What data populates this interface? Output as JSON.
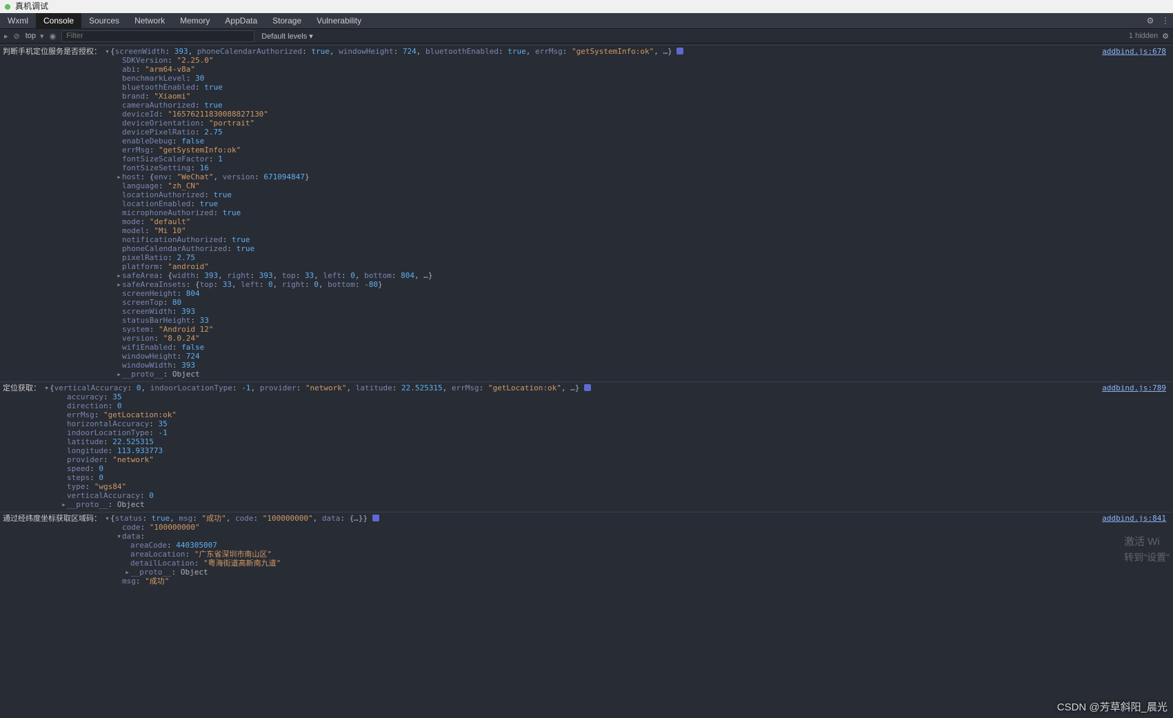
{
  "window": {
    "title": "真机调试"
  },
  "tabs": [
    "Wxml",
    "Console",
    "Sources",
    "Network",
    "Memory",
    "AppData",
    "Storage",
    "Vulnerability"
  ],
  "active_tab": "Console",
  "toolbar": {
    "context": "top",
    "filter_placeholder": "Filter",
    "levels": "Default levels",
    "hidden": "1 hidden"
  },
  "msgs": [
    {
      "label": "判断手机定位服务是否授权：",
      "source": "addbind.js:678",
      "summary": {
        "screenWidth": 393,
        "phoneCalendarAuthorized": true,
        "windowHeight": 724,
        "bluetoothEnabled": true,
        "errMsg": "getSystemInfo:ok",
        "more": "…"
      },
      "props": [
        {
          "k": "SDKVersion",
          "v": "2.25.0",
          "t": "str"
        },
        {
          "k": "abi",
          "v": "arm64-v8a",
          "t": "str"
        },
        {
          "k": "benchmarkLevel",
          "v": 30,
          "t": "num"
        },
        {
          "k": "bluetoothEnabled",
          "v": true,
          "t": "bool"
        },
        {
          "k": "brand",
          "v": "Xiaomi",
          "t": "str"
        },
        {
          "k": "cameraAuthorized",
          "v": true,
          "t": "bool"
        },
        {
          "k": "deviceId",
          "v": "16576211830088827130",
          "t": "str"
        },
        {
          "k": "deviceOrientation",
          "v": "portrait",
          "t": "str"
        },
        {
          "k": "devicePixelRatio",
          "v": 2.75,
          "t": "num"
        },
        {
          "k": "enableDebug",
          "v": false,
          "t": "bool"
        },
        {
          "k": "errMsg",
          "v": "getSystemInfo:ok",
          "t": "str"
        },
        {
          "k": "fontSizeScaleFactor",
          "v": 1,
          "t": "num"
        },
        {
          "k": "fontSizeSetting",
          "v": 16,
          "t": "num"
        },
        {
          "k": "host",
          "raw": "{env: \"WeChat\", version: 671094847}",
          "t": "obj",
          "tri": true
        },
        {
          "k": "language",
          "v": "zh_CN",
          "t": "str"
        },
        {
          "k": "locationAuthorized",
          "v": true,
          "t": "bool"
        },
        {
          "k": "locationEnabled",
          "v": true,
          "t": "bool"
        },
        {
          "k": "microphoneAuthorized",
          "v": true,
          "t": "bool"
        },
        {
          "k": "mode",
          "v": "default",
          "t": "str"
        },
        {
          "k": "model",
          "v": "Mi 10",
          "t": "str"
        },
        {
          "k": "notificationAuthorized",
          "v": true,
          "t": "bool"
        },
        {
          "k": "phoneCalendarAuthorized",
          "v": true,
          "t": "bool"
        },
        {
          "k": "pixelRatio",
          "v": 2.75,
          "t": "num"
        },
        {
          "k": "platform",
          "v": "android",
          "t": "str"
        },
        {
          "k": "safeArea",
          "raw": "{width: 393, right: 393, top: 33, left: 0, bottom: 804, …}",
          "t": "obj",
          "tri": true
        },
        {
          "k": "safeAreaInsets",
          "raw": "{top: 33, left: 0, right: 0, bottom: -80}",
          "t": "obj",
          "tri": true
        },
        {
          "k": "screenHeight",
          "v": 804,
          "t": "num"
        },
        {
          "k": "screenTop",
          "v": 80,
          "t": "num"
        },
        {
          "k": "screenWidth",
          "v": 393,
          "t": "num"
        },
        {
          "k": "statusBarHeight",
          "v": 33,
          "t": "num"
        },
        {
          "k": "system",
          "v": "Android 12",
          "t": "str"
        },
        {
          "k": "version",
          "v": "8.0.24",
          "t": "str"
        },
        {
          "k": "wifiEnabled",
          "v": false,
          "t": "bool"
        },
        {
          "k": "windowHeight",
          "v": 724,
          "t": "num"
        },
        {
          "k": "windowWidth",
          "v": 393,
          "t": "num"
        },
        {
          "k": "__proto__",
          "raw": "Object",
          "t": "raw",
          "tri": true
        }
      ]
    },
    {
      "label": "定位获取：",
      "source": "addbind.js:789",
      "summary": {
        "verticalAccuracy": 0,
        "indoorLocationType": -1,
        "provider": "network",
        "latitude": 22.525315,
        "errMsg": "getLocation:ok",
        "more": "…"
      },
      "props": [
        {
          "k": "accuracy",
          "v": 35,
          "t": "num"
        },
        {
          "k": "direction",
          "v": 0,
          "t": "num"
        },
        {
          "k": "errMsg",
          "v": "getLocation:ok",
          "t": "str"
        },
        {
          "k": "horizontalAccuracy",
          "v": 35,
          "t": "num"
        },
        {
          "k": "indoorLocationType",
          "v": -1,
          "t": "num"
        },
        {
          "k": "latitude",
          "v": 22.525315,
          "t": "num"
        },
        {
          "k": "longitude",
          "v": 113.933773,
          "t": "num"
        },
        {
          "k": "provider",
          "v": "network",
          "t": "str"
        },
        {
          "k": "speed",
          "v": 0,
          "t": "num"
        },
        {
          "k": "steps",
          "v": 0,
          "t": "num"
        },
        {
          "k": "type",
          "v": "wgs84",
          "t": "str"
        },
        {
          "k": "verticalAccuracy",
          "v": 0,
          "t": "num"
        },
        {
          "k": "__proto__",
          "raw": "Object",
          "t": "raw",
          "tri": true
        }
      ],
      "propsIndent": "props2"
    },
    {
      "label": "通过经纬度坐标获取区域码：",
      "source": "addbind.js:841",
      "summary": {
        "status": true,
        "msg": "成功",
        "code": "100000000",
        "data": "{…}"
      },
      "props": [
        {
          "k": "code",
          "v": "100000000",
          "t": "str"
        },
        {
          "k": "data",
          "raw": "",
          "t": "obj",
          "tri": true,
          "open": true,
          "children": [
            {
              "k": "areaCode",
              "v": 440305007,
              "t": "num"
            },
            {
              "k": "areaLocation",
              "v": "广东省深圳市南山区",
              "t": "str"
            },
            {
              "k": "detailLocation",
              "v": "粤海街道高新南九道",
              "t": "str"
            },
            {
              "k": "__proto__",
              "raw": "Object",
              "t": "raw",
              "tri": true
            }
          ]
        },
        {
          "k": "msg",
          "v": "成功",
          "t": "str"
        }
      ],
      "propsIndent": "props3"
    }
  ],
  "watermark": {
    "line1": "激活 Wi",
    "line2": "转到\"设置\""
  },
  "csdn": "CSDN @芳草斜阳_晨光"
}
